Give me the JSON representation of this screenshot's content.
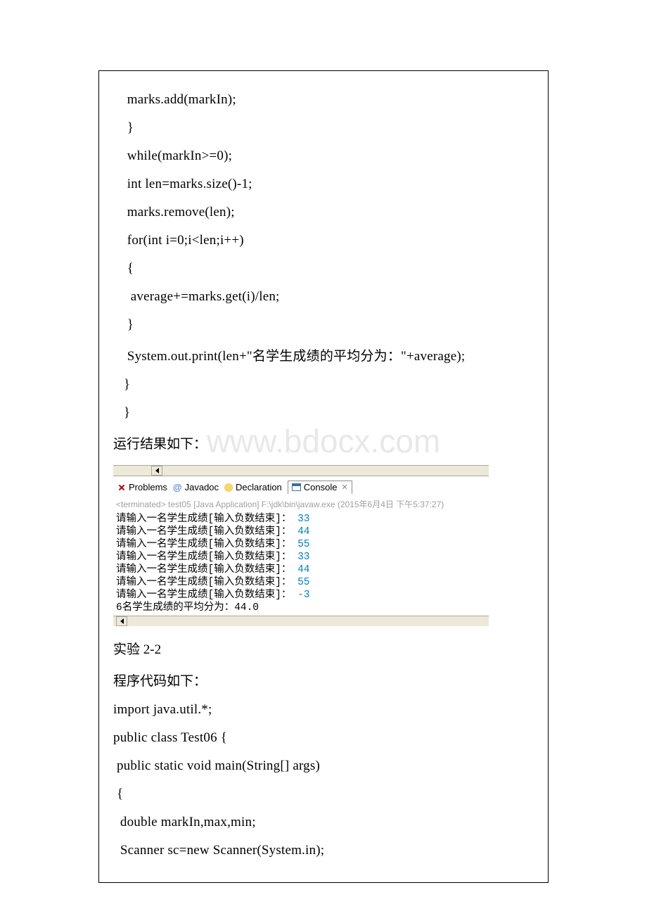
{
  "code_top": {
    "l1": "    marks.add(markIn);",
    "l2": "    }",
    "l3": "    while(markIn>=0);",
    "l4": "    int len=marks.size()-1;",
    "l5": "    marks.remove(len);",
    "l6": "    for(int i=0;i<len;i++)",
    "l7": "    {",
    "l8": "     average+=marks.get(i)/len;",
    "l9": "    }",
    "l10": "    System.out.print(len+\"名学生成绩的平均分为：\"+average);",
    "l11": "   }",
    "l12": "   }"
  },
  "run_label": "运行结果如下：",
  "eclipse": {
    "tabs": {
      "problems": "Problems",
      "javadoc": "Javadoc",
      "declaration": "Declaration",
      "console": "Console"
    },
    "terminated": "<terminated> test05 [Java Application] F:\\jdk\\bin\\javaw.exe (2015年6月4日 下午5:37:27)",
    "rows": [
      {
        "p": "请输入一名学生成绩[输入负数结束]：",
        "v": "33"
      },
      {
        "p": "请输入一名学生成绩[输入负数结束]：",
        "v": "44"
      },
      {
        "p": "请输入一名学生成绩[输入负数结束]：",
        "v": "55"
      },
      {
        "p": "请输入一名学生成绩[输入负数结束]：",
        "v": "33"
      },
      {
        "p": "请输入一名学生成绩[输入负数结束]：",
        "v": "44"
      },
      {
        "p": "请输入一名学生成绩[输入负数结束]：",
        "v": "55"
      },
      {
        "p": "请输入一名学生成绩[输入负数结束]：",
        "v": "-3"
      }
    ],
    "summary": "6名学生成绩的平均分为：44.0"
  },
  "section2": {
    "heading": "  实验 2-2",
    "sub": "程序代码如下：",
    "c1": "import java.util.*;",
    "c2": "public class Test06 {",
    "c3": " public static void main(String[] args)",
    "c4": " {",
    "c5": "  double markIn,max,min;",
    "c6": "  Scanner sc=new Scanner(System.in);"
  },
  "watermark_text": "www.bdocx.com"
}
